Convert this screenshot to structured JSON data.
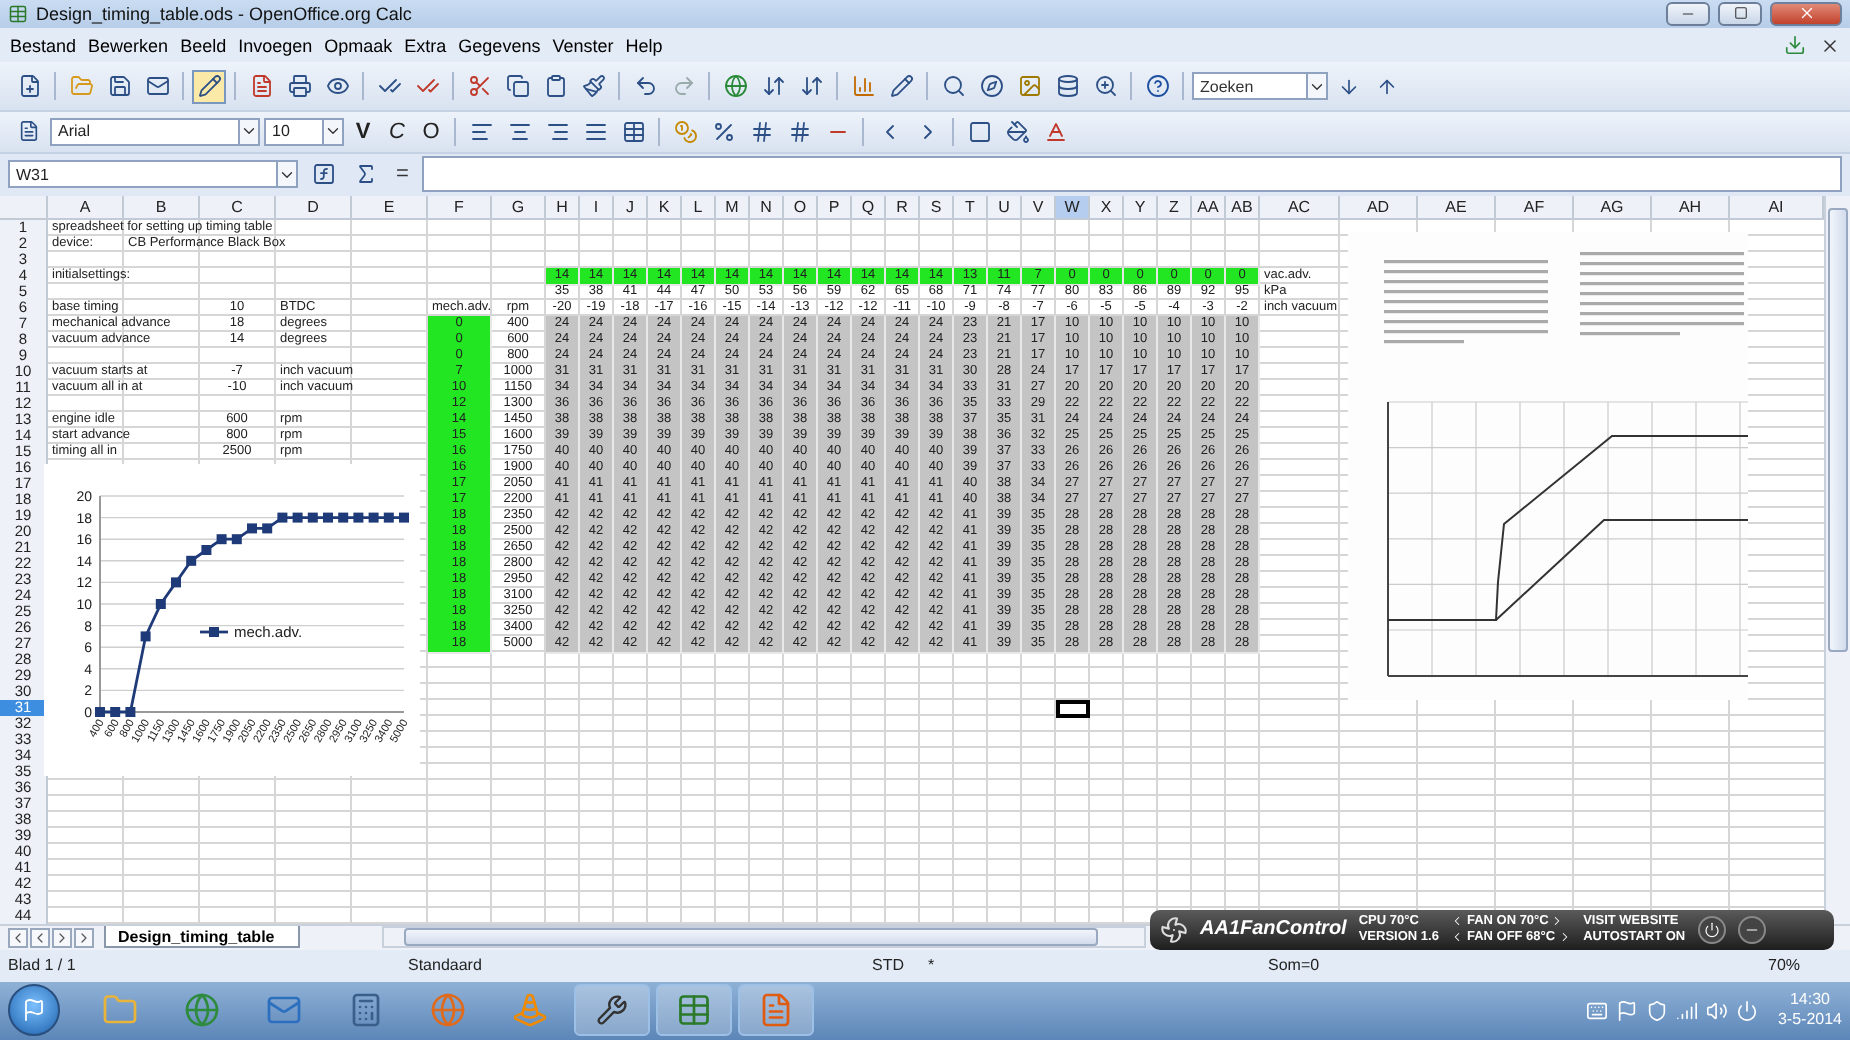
{
  "window": {
    "title": "Design_timing_table.ods - OpenOffice.org Calc"
  },
  "menu": [
    "Bestand",
    "Bewerken",
    "Beeld",
    "Invoegen",
    "Opmaak",
    "Extra",
    "Gegevens",
    "Venster",
    "Help"
  ],
  "search": {
    "placeholder": "Zoeken"
  },
  "format_bar": {
    "font": "Arial",
    "size": "10",
    "bold": "V",
    "italic": "C",
    "underline": "O"
  },
  "formula_bar": {
    "name_box": "W31",
    "equals": "="
  },
  "columns": [
    {
      "label": "A",
      "selected": false
    },
    {
      "label": "B",
      "selected": false
    },
    {
      "label": "C",
      "selected": false
    },
    {
      "label": "D",
      "selected": false
    },
    {
      "label": "E",
      "selected": false
    },
    {
      "label": "F",
      "selected": false
    },
    {
      "label": "G",
      "selected": false
    },
    {
      "label": "H",
      "selected": false
    },
    {
      "label": "I",
      "selected": false
    },
    {
      "label": "J",
      "selected": false
    },
    {
      "label": "K",
      "selected": false
    },
    {
      "label": "L",
      "selected": false
    },
    {
      "label": "M",
      "selected": false
    },
    {
      "label": "N",
      "selected": false
    },
    {
      "label": "O",
      "selected": false
    },
    {
      "label": "P",
      "selected": false
    },
    {
      "label": "Q",
      "selected": false
    },
    {
      "label": "R",
      "selected": false
    },
    {
      "label": "S",
      "selected": false
    },
    {
      "label": "T",
      "selected": false
    },
    {
      "label": "U",
      "selected": false
    },
    {
      "label": "V",
      "selected": false
    },
    {
      "label": "W",
      "selected": true
    },
    {
      "label": "X",
      "selected": false
    },
    {
      "label": "Y",
      "selected": false
    },
    {
      "label": "Z",
      "selected": false
    },
    {
      "label": "AA",
      "selected": false
    },
    {
      "label": "AB",
      "selected": false
    },
    {
      "label": "AC",
      "selected": false
    },
    {
      "label": "AD",
      "selected": false
    },
    {
      "label": "AE",
      "selected": false
    },
    {
      "label": "AF",
      "selected": false
    },
    {
      "label": "AG",
      "selected": false
    },
    {
      "label": "AH",
      "selected": false
    },
    {
      "label": "AI",
      "selected": false
    }
  ],
  "rows": [
    {
      "header": "1",
      "selected": false,
      "cells": {
        "A": {
          "text": "spreadsheet for setting up timing table",
          "kind": "text"
        }
      }
    },
    {
      "header": "2",
      "selected": false,
      "cells": {
        "A": {
          "text": "device:",
          "kind": "text"
        },
        "B": {
          "text": "CB Performance Black Box",
          "kind": "text"
        }
      }
    },
    {
      "header": "3",
      "selected": false
    },
    {
      "header": "4",
      "selected": false,
      "cells": {
        "A": {
          "text": "initialsettings:",
          "kind": "text"
        },
        "AC": {
          "text": "vac.adv.",
          "kind": "text"
        }
      },
      "band": {
        "kind": "green",
        "values": [
          "14",
          "14",
          "14",
          "14",
          "14",
          "14",
          "14",
          "14",
          "14",
          "14",
          "14",
          "14",
          "13",
          "11",
          "7",
          "0",
          "0",
          "0",
          "0",
          "0",
          "0"
        ]
      }
    },
    {
      "header": "5",
      "selected": false,
      "cells": {
        "AC": {
          "text": "kPa",
          "kind": "text"
        }
      },
      "band": {
        "kind": "plain",
        "values": [
          "35",
          "38",
          "41",
          "44",
          "47",
          "50",
          "53",
          "56",
          "59",
          "62",
          "65",
          "68",
          "71",
          "74",
          "77",
          "80",
          "83",
          "86",
          "89",
          "92",
          "95"
        ]
      }
    },
    {
      "header": "6",
      "selected": false,
      "cells": {
        "A": {
          "text": "base timing",
          "kind": "text"
        },
        "C": {
          "text": "10",
          "kind": "number"
        },
        "D": {
          "text": "BTDC",
          "kind": "text"
        },
        "F": {
          "text": "mech.adv.",
          "kind": "number"
        },
        "G": {
          "text": "rpm",
          "kind": "number"
        },
        "AC": {
          "text": "inch vacuum",
          "kind": "text"
        }
      },
      "band": {
        "kind": "plain",
        "values": [
          "-20",
          "-19",
          "-18",
          "-17",
          "-16",
          "-15",
          "-14",
          "-13",
          "-12",
          "-12",
          "-11",
          "-10",
          "-9",
          "-8",
          "-7",
          "-6",
          "-5",
          "-5",
          "-4",
          "-3",
          "-2"
        ]
      }
    },
    {
      "header": "7",
      "selected": false,
      "cells": {
        "A": {
          "text": "mechanical advance",
          "kind": "text"
        },
        "C": {
          "text": "18",
          "kind": "number"
        },
        "D": {
          "text": "degrees",
          "kind": "text"
        },
        "F": {
          "text": "0",
          "kind": "green"
        },
        "G": {
          "text": "400",
          "kind": "number"
        }
      },
      "band": {
        "kind": "shaded",
        "values": [
          "24",
          "24",
          "24",
          "24",
          "24",
          "24",
          "24",
          "24",
          "24",
          "24",
          "24",
          "24",
          "23",
          "21",
          "17",
          "10",
          "10",
          "10",
          "10",
          "10",
          "10"
        ]
      }
    },
    {
      "header": "8",
      "selected": false,
      "cells": {
        "A": {
          "text": "vacuum advance",
          "kind": "text"
        },
        "C": {
          "text": "14",
          "kind": "number"
        },
        "D": {
          "text": "degrees",
          "kind": "text"
        },
        "F": {
          "text": "0",
          "kind": "green"
        },
        "G": {
          "text": "600",
          "kind": "number"
        }
      },
      "band": {
        "kind": "shaded",
        "values": [
          "24",
          "24",
          "24",
          "24",
          "24",
          "24",
          "24",
          "24",
          "24",
          "24",
          "24",
          "24",
          "23",
          "21",
          "17",
          "10",
          "10",
          "10",
          "10",
          "10",
          "10"
        ]
      }
    },
    {
      "header": "9",
      "selected": false,
      "cells": {
        "F": {
          "text": "0",
          "kind": "green"
        },
        "G": {
          "text": "800",
          "kind": "number"
        }
      },
      "band": {
        "kind": "shaded",
        "values": [
          "24",
          "24",
          "24",
          "24",
          "24",
          "24",
          "24",
          "24",
          "24",
          "24",
          "24",
          "24",
          "23",
          "21",
          "17",
          "10",
          "10",
          "10",
          "10",
          "10",
          "10"
        ]
      }
    },
    {
      "header": "10",
      "selected": false,
      "cells": {
        "A": {
          "text": "vacuum starts at",
          "kind": "text"
        },
        "C": {
          "text": "-7",
          "kind": "number"
        },
        "D": {
          "text": "inch vacuum",
          "kind": "text"
        },
        "F": {
          "text": "7",
          "kind": "green"
        },
        "G": {
          "text": "1000",
          "kind": "number"
        }
      },
      "band": {
        "kind": "shaded",
        "values": [
          "31",
          "31",
          "31",
          "31",
          "31",
          "31",
          "31",
          "31",
          "31",
          "31",
          "31",
          "31",
          "30",
          "28",
          "24",
          "17",
          "17",
          "17",
          "17",
          "17",
          "17"
        ]
      }
    },
    {
      "header": "11",
      "selected": false,
      "cells": {
        "A": {
          "text": "vacuum all in at",
          "kind": "text"
        },
        "C": {
          "text": "-10",
          "kind": "number"
        },
        "D": {
          "text": "inch vacuum",
          "kind": "text"
        },
        "F": {
          "text": "10",
          "kind": "green"
        },
        "G": {
          "text": "1150",
          "kind": "number"
        }
      },
      "band": {
        "kind": "shaded",
        "values": [
          "34",
          "34",
          "34",
          "34",
          "34",
          "34",
          "34",
          "34",
          "34",
          "34",
          "34",
          "34",
          "33",
          "31",
          "27",
          "20",
          "20",
          "20",
          "20",
          "20",
          "20"
        ]
      }
    },
    {
      "header": "12",
      "selected": false,
      "cells": {
        "F": {
          "text": "12",
          "kind": "green"
        },
        "G": {
          "text": "1300",
          "kind": "number"
        }
      },
      "band": {
        "kind": "shaded",
        "values": [
          "36",
          "36",
          "36",
          "36",
          "36",
          "36",
          "36",
          "36",
          "36",
          "36",
          "36",
          "36",
          "35",
          "33",
          "29",
          "22",
          "22",
          "22",
          "22",
          "22",
          "22"
        ]
      }
    },
    {
      "header": "13",
      "selected": false,
      "cells": {
        "A": {
          "text": "engine idle",
          "kind": "text"
        },
        "C": {
          "text": "600",
          "kind": "number"
        },
        "D": {
          "text": "rpm",
          "kind": "text"
        },
        "F": {
          "text": "14",
          "kind": "green"
        },
        "G": {
          "text": "1450",
          "kind": "number"
        }
      },
      "band": {
        "kind": "shaded",
        "values": [
          "38",
          "38",
          "38",
          "38",
          "38",
          "38",
          "38",
          "38",
          "38",
          "38",
          "38",
          "38",
          "37",
          "35",
          "31",
          "24",
          "24",
          "24",
          "24",
          "24",
          "24"
        ]
      }
    },
    {
      "header": "14",
      "selected": false,
      "cells": {
        "A": {
          "text": "start advance",
          "kind": "text"
        },
        "C": {
          "text": "800",
          "kind": "number"
        },
        "D": {
          "text": "rpm",
          "kind": "text"
        },
        "F": {
          "text": "15",
          "kind": "green"
        },
        "G": {
          "text": "1600",
          "kind": "number"
        }
      },
      "band": {
        "kind": "shaded",
        "values": [
          "39",
          "39",
          "39",
          "39",
          "39",
          "39",
          "39",
          "39",
          "39",
          "39",
          "39",
          "39",
          "38",
          "36",
          "32",
          "25",
          "25",
          "25",
          "25",
          "25",
          "25"
        ]
      }
    },
    {
      "header": "15",
      "selected": false,
      "cells": {
        "A": {
          "text": "timing all in",
          "kind": "text"
        },
        "C": {
          "text": "2500",
          "kind": "number"
        },
        "D": {
          "text": "rpm",
          "kind": "text"
        },
        "F": {
          "text": "16",
          "kind": "green"
        },
        "G": {
          "text": "1750",
          "kind": "number"
        }
      },
      "band": {
        "kind": "shaded",
        "values": [
          "40",
          "40",
          "40",
          "40",
          "40",
          "40",
          "40",
          "40",
          "40",
          "40",
          "40",
          "40",
          "39",
          "37",
          "33",
          "26",
          "26",
          "26",
          "26",
          "26",
          "26"
        ]
      }
    },
    {
      "header": "16",
      "selected": false,
      "cells": {
        "F": {
          "text": "16",
          "kind": "green"
        },
        "G": {
          "text": "1900",
          "kind": "number"
        }
      },
      "band": {
        "kind": "shaded",
        "values": [
          "40",
          "40",
          "40",
          "40",
          "40",
          "40",
          "40",
          "40",
          "40",
          "40",
          "40",
          "40",
          "39",
          "37",
          "33",
          "26",
          "26",
          "26",
          "26",
          "26",
          "26"
        ]
      }
    },
    {
      "header": "17",
      "selected": false,
      "cells": {
        "F": {
          "text": "17",
          "kind": "green"
        },
        "G": {
          "text": "2050",
          "kind": "number"
        }
      },
      "band": {
        "kind": "shaded",
        "values": [
          "41",
          "41",
          "41",
          "41",
          "41",
          "41",
          "41",
          "41",
          "41",
          "41",
          "41",
          "41",
          "40",
          "38",
          "34",
          "27",
          "27",
          "27",
          "27",
          "27",
          "27"
        ]
      }
    },
    {
      "header": "18",
      "selected": false,
      "cells": {
        "F": {
          "text": "17",
          "kind": "green"
        },
        "G": {
          "text": "2200",
          "kind": "number"
        }
      },
      "band": {
        "kind": "shaded",
        "values": [
          "41",
          "41",
          "41",
          "41",
          "41",
          "41",
          "41",
          "41",
          "41",
          "41",
          "41",
          "41",
          "40",
          "38",
          "34",
          "27",
          "27",
          "27",
          "27",
          "27",
          "27"
        ]
      }
    },
    {
      "header": "19",
      "selected": false,
      "cells": {
        "F": {
          "text": "18",
          "kind": "green"
        },
        "G": {
          "text": "2350",
          "kind": "number"
        }
      },
      "band": {
        "kind": "shaded",
        "values": [
          "42",
          "42",
          "42",
          "42",
          "42",
          "42",
          "42",
          "42",
          "42",
          "42",
          "42",
          "42",
          "41",
          "39",
          "35",
          "28",
          "28",
          "28",
          "28",
          "28",
          "28"
        ]
      }
    },
    {
      "header": "20",
      "selected": false,
      "cells": {
        "F": {
          "text": "18",
          "kind": "green"
        },
        "G": {
          "text": "2500",
          "kind": "number"
        }
      },
      "band": {
        "kind": "shaded",
        "values": [
          "42",
          "42",
          "42",
          "42",
          "42",
          "42",
          "42",
          "42",
          "42",
          "42",
          "42",
          "42",
          "41",
          "39",
          "35",
          "28",
          "28",
          "28",
          "28",
          "28",
          "28"
        ]
      }
    },
    {
      "header": "21",
      "selected": false,
      "cells": {
        "F": {
          "text": "18",
          "kind": "green"
        },
        "G": {
          "text": "2650",
          "kind": "number"
        }
      },
      "band": {
        "kind": "shaded",
        "values": [
          "42",
          "42",
          "42",
          "42",
          "42",
          "42",
          "42",
          "42",
          "42",
          "42",
          "42",
          "42",
          "41",
          "39",
          "35",
          "28",
          "28",
          "28",
          "28",
          "28",
          "28"
        ]
      }
    },
    {
      "header": "22",
      "selected": false,
      "cells": {
        "F": {
          "text": "18",
          "kind": "green"
        },
        "G": {
          "text": "2800",
          "kind": "number"
        }
      },
      "band": {
        "kind": "shaded",
        "values": [
          "42",
          "42",
          "42",
          "42",
          "42",
          "42",
          "42",
          "42",
          "42",
          "42",
          "42",
          "42",
          "41",
          "39",
          "35",
          "28",
          "28",
          "28",
          "28",
          "28",
          "28"
        ]
      }
    },
    {
      "header": "23",
      "selected": false,
      "cells": {
        "F": {
          "text": "18",
          "kind": "green"
        },
        "G": {
          "text": "2950",
          "kind": "number"
        }
      },
      "band": {
        "kind": "shaded",
        "values": [
          "42",
          "42",
          "42",
          "42",
          "42",
          "42",
          "42",
          "42",
          "42",
          "42",
          "42",
          "42",
          "41",
          "39",
          "35",
          "28",
          "28",
          "28",
          "28",
          "28",
          "28"
        ]
      }
    },
    {
      "header": "24",
      "selected": false,
      "cells": {
        "F": {
          "text": "18",
          "kind": "green"
        },
        "G": {
          "text": "3100",
          "kind": "number"
        }
      },
      "band": {
        "kind": "shaded",
        "values": [
          "42",
          "42",
          "42",
          "42",
          "42",
          "42",
          "42",
          "42",
          "42",
          "42",
          "42",
          "42",
          "41",
          "39",
          "35",
          "28",
          "28",
          "28",
          "28",
          "28",
          "28"
        ]
      }
    },
    {
      "header": "25",
      "selected": false,
      "cells": {
        "F": {
          "text": "18",
          "kind": "green"
        },
        "G": {
          "text": "3250",
          "kind": "number"
        }
      },
      "band": {
        "kind": "shaded",
        "values": [
          "42",
          "42",
          "42",
          "42",
          "42",
          "42",
          "42",
          "42",
          "42",
          "42",
          "42",
          "42",
          "41",
          "39",
          "35",
          "28",
          "28",
          "28",
          "28",
          "28",
          "28"
        ]
      }
    },
    {
      "header": "26",
      "selected": false,
      "cells": {
        "F": {
          "text": "18",
          "kind": "green"
        },
        "G": {
          "text": "3400",
          "kind": "number"
        }
      },
      "band": {
        "kind": "shaded",
        "values": [
          "42",
          "42",
          "42",
          "42",
          "42",
          "42",
          "42",
          "42",
          "42",
          "42",
          "42",
          "42",
          "41",
          "39",
          "35",
          "28",
          "28",
          "28",
          "28",
          "28",
          "28"
        ]
      }
    },
    {
      "header": "27",
      "selected": false,
      "cells": {
        "F": {
          "text": "18",
          "kind": "green"
        },
        "G": {
          "text": "5000",
          "kind": "number"
        }
      },
      "band": {
        "kind": "shaded",
        "values": [
          "42",
          "42",
          "42",
          "42",
          "42",
          "42",
          "42",
          "42",
          "42",
          "42",
          "42",
          "42",
          "41",
          "39",
          "35",
          "28",
          "28",
          "28",
          "28",
          "28",
          "28"
        ]
      }
    },
    {
      "header": "28",
      "selected": false
    },
    {
      "header": "29",
      "selected": false
    },
    {
      "header": "30",
      "selected": false
    },
    {
      "header": "31",
      "selected": true
    },
    {
      "header": "32",
      "selected": false
    },
    {
      "header": "33",
      "selected": false
    },
    {
      "header": "34",
      "selected": false
    },
    {
      "header": "35",
      "selected": false
    },
    {
      "header": "36",
      "selected": false
    },
    {
      "header": "37",
      "selected": false
    },
    {
      "header": "38",
      "selected": false
    },
    {
      "header": "39",
      "selected": false
    },
    {
      "header": "40",
      "selected": false
    },
    {
      "header": "41",
      "selected": false
    },
    {
      "header": "42",
      "selected": false
    },
    {
      "header": "43",
      "selected": false
    },
    {
      "header": "44",
      "selected": false
    }
  ],
  "chart": {
    "chart_data": {
      "type": "line",
      "categories": [
        "400",
        "600",
        "800",
        "1000",
        "1150",
        "1300",
        "1450",
        "1600",
        "1750",
        "1900",
        "2050",
        "2200",
        "2350",
        "2500",
        "2650",
        "2800",
        "2950",
        "3100",
        "3250",
        "3400",
        "5000"
      ],
      "series": [
        {
          "name": "mech.adv.",
          "color": "#1f3a78",
          "marker": "square",
          "values": [
            0,
            0,
            0,
            7,
            10,
            12,
            14,
            15,
            16,
            16,
            17,
            17,
            18,
            18,
            18,
            18,
            18,
            18,
            18,
            18,
            18
          ]
        }
      ],
      "grid": true,
      "ylim": [
        0,
        20
      ],
      "yticks": [
        0,
        2,
        4,
        6,
        8,
        10,
        12,
        14,
        16,
        18,
        20
      ]
    }
  },
  "sheet_tabs": [
    {
      "label": "Design_timing_table",
      "selected": true
    }
  ],
  "status_bar": {
    "sheet": "Blad 1 / 1",
    "style": "Standaard",
    "mode": "STD",
    "modified": "*",
    "sum": "Som=0",
    "zoom": "70%"
  },
  "fan_widget": {
    "title": "AA1FanControl",
    "cpu": "CPU 70°C",
    "version": "VERSION 1.6",
    "fan_on": "FAN ON 70°C",
    "fan_off": "FAN OFF 68°C",
    "website": "VISIT WEBSITE",
    "autostart": "AUTOSTART ON"
  },
  "taskbar": {
    "time": "14:30",
    "date": "3-5-2014"
  }
}
